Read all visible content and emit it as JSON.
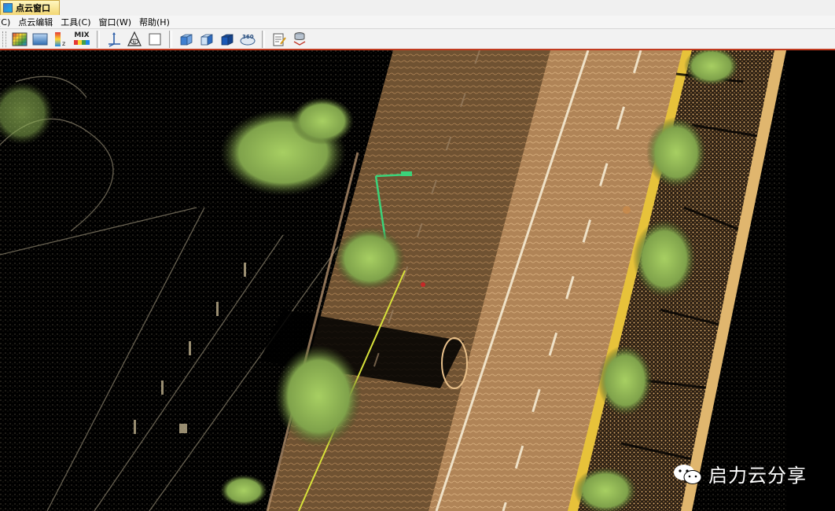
{
  "window": {
    "tab_title": "点云窗口"
  },
  "menu": {
    "items": [
      "(C)",
      "点云编辑",
      "工具(C)",
      "窗口(W)",
      "帮助(H)"
    ]
  },
  "toolbar": {
    "mix_label": "MIX",
    "buttons": [
      {
        "icon": "elevation-color-grid-icon"
      },
      {
        "icon": "intensity-color-icon"
      },
      {
        "icon": "height-z-gradient-icon"
      },
      {
        "icon": "mix-color-icon"
      },
      {
        "icon": "axis-coordinate-icon"
      },
      {
        "icon": "north-compass-icon"
      },
      {
        "icon": "blank-square-icon"
      },
      {
        "icon": "front-view-cube-icon"
      },
      {
        "icon": "side-view-cube-icon"
      },
      {
        "icon": "solid-view-cube-icon"
      },
      {
        "icon": "view-360-icon"
      },
      {
        "icon": "edit-notepad-icon"
      },
      {
        "icon": "layer-database-icon"
      }
    ]
  },
  "viewport": {
    "scene": "point-cloud road scene",
    "colors": {
      "road": "#7a5a3a",
      "road_light": "#c49a6a",
      "sidewalk": "#d9a96a",
      "trees": "#8fb55a",
      "curb_line": "#e8d13a",
      "lamp": "#3bd37a",
      "background": "#000000"
    }
  },
  "watermark": {
    "text": "启力云分享"
  }
}
